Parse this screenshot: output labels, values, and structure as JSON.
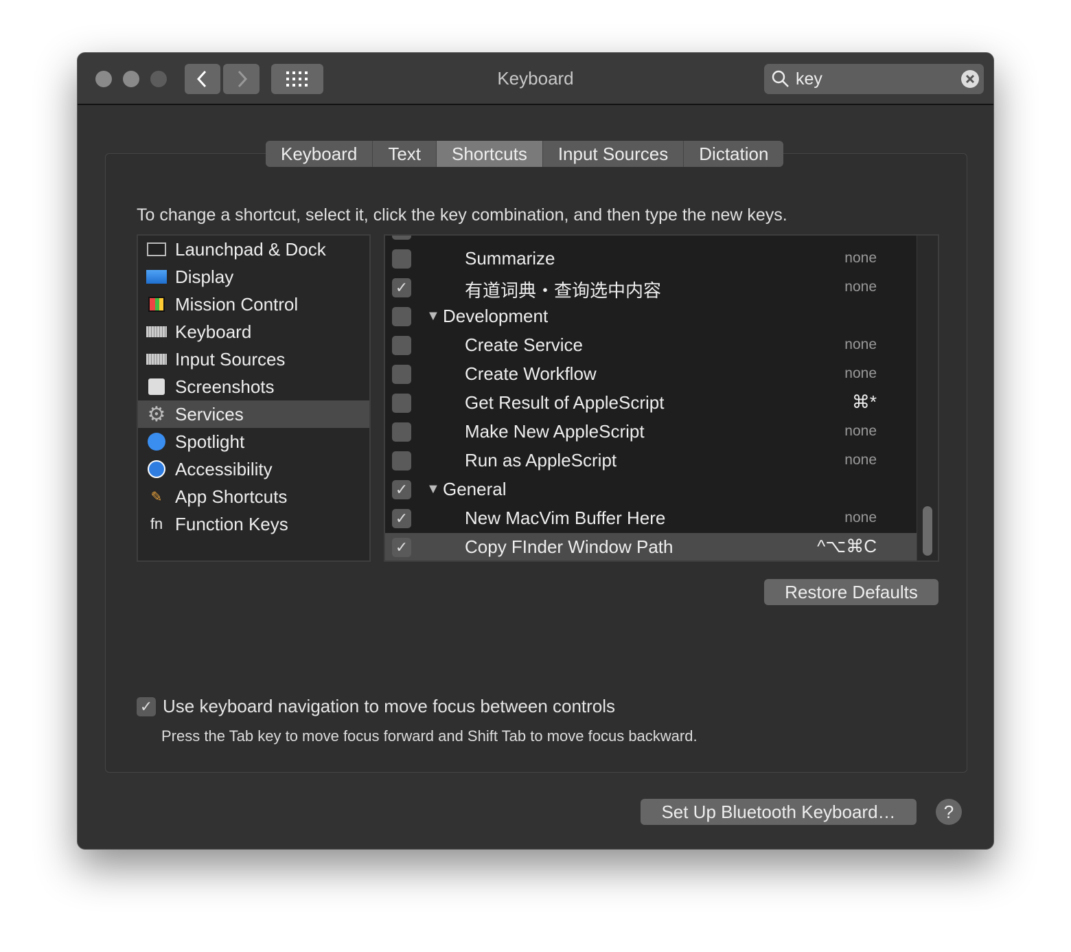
{
  "window": {
    "title": "Keyboard"
  },
  "search": {
    "value": "key"
  },
  "tabs": [
    {
      "label": "Keyboard"
    },
    {
      "label": "Text"
    },
    {
      "label": "Shortcuts",
      "selected": true
    },
    {
      "label": "Input Sources"
    },
    {
      "label": "Dictation"
    }
  ],
  "instruction": "To change a shortcut, select it, click the key combination, and then type the new keys.",
  "categories": [
    {
      "label": "Launchpad & Dock",
      "icon": "launchpad-icon"
    },
    {
      "label": "Display",
      "icon": "display-icon"
    },
    {
      "label": "Mission Control",
      "icon": "mission-control-icon"
    },
    {
      "label": "Keyboard",
      "icon": "keyboard-icon"
    },
    {
      "label": "Input Sources",
      "icon": "keyboard-icon"
    },
    {
      "label": "Screenshots",
      "icon": "screenshot-icon"
    },
    {
      "label": "Services",
      "icon": "gear-icon",
      "selected": true
    },
    {
      "label": "Spotlight",
      "icon": "spotlight-icon"
    },
    {
      "label": "Accessibility",
      "icon": "accessibility-icon"
    },
    {
      "label": "App Shortcuts",
      "icon": "app-shortcuts-icon"
    },
    {
      "label": "Function Keys",
      "icon": "fn-icon",
      "glyph": "fn"
    }
  ],
  "shortcuts": [
    {
      "label": "Summarize",
      "checked": false,
      "key": "none",
      "level": 1
    },
    {
      "label": "有道词典・查询选中内容",
      "checked": true,
      "key": "none",
      "level": 1
    },
    {
      "label": "Development",
      "checked": false,
      "key": "",
      "level": 0,
      "group": true
    },
    {
      "label": "Create Service",
      "checked": false,
      "key": "none",
      "level": 1
    },
    {
      "label": "Create Workflow",
      "checked": false,
      "key": "none",
      "level": 1
    },
    {
      "label": "Get Result of AppleScript",
      "checked": false,
      "key": "⌘*",
      "level": 1,
      "assigned": true
    },
    {
      "label": "Make New AppleScript",
      "checked": false,
      "key": "none",
      "level": 1
    },
    {
      "label": "Run as AppleScript",
      "checked": false,
      "key": "none",
      "level": 1
    },
    {
      "label": "General",
      "checked": true,
      "key": "",
      "level": 0,
      "group": true
    },
    {
      "label": "New MacVim Buffer Here",
      "checked": true,
      "key": "none",
      "level": 1
    },
    {
      "label": "Copy FInder Window Path",
      "checked": true,
      "key": "^⌥⌘C",
      "level": 1,
      "assigned": true,
      "selected": true
    }
  ],
  "restore_label": "Restore Defaults",
  "keyboard_nav": {
    "checked": true,
    "label": "Use keyboard navigation to move focus between controls",
    "hint": "Press the Tab key to move focus forward and Shift Tab to move focus backward."
  },
  "bluetooth_label": "Set Up Bluetooth Keyboard…",
  "help_label": "?"
}
